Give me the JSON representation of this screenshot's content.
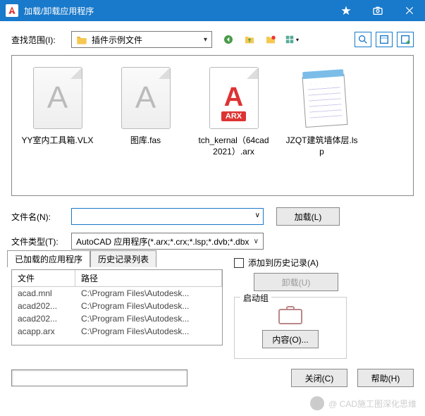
{
  "window": {
    "title": "加载/卸载应用程序"
  },
  "lookIn": {
    "label": "查找范围(I):",
    "value": "插件示例文件"
  },
  "rightTools": [
    "view-tree",
    "view-list",
    "view-add"
  ],
  "files": [
    {
      "name": "YY室内工具箱.VLX",
      "kind": "plain"
    },
    {
      "name": "图库.fas",
      "kind": "plain"
    },
    {
      "name": "tch_kernal（64cad2021）.arx",
      "kind": "arx",
      "badge": "ARX"
    },
    {
      "name": "JZQT建筑墙体层.lsp",
      "kind": "notepad"
    }
  ],
  "fileName": {
    "label": "文件名(N):",
    "value": ""
  },
  "fileType": {
    "label": "文件类型(T):",
    "value": "AutoCAD 应用程序(*.arx;*.crx;*.lsp;*.dvb;*.dbx"
  },
  "buttons": {
    "load": "加载(L)",
    "unload": "卸载(U)",
    "contents": "内容(O)...",
    "close": "关闭(C)",
    "help": "帮助(H)"
  },
  "tabs": {
    "loaded": "已加载的应用程序",
    "history": "历史记录列表"
  },
  "listHeaders": {
    "file": "文件",
    "path": "路径"
  },
  "loadedApps": [
    {
      "file": "acad.mnl",
      "path": "C:\\Program Files\\Autodesk..."
    },
    {
      "file": "acad202...",
      "path": "C:\\Program Files\\Autodesk..."
    },
    {
      "file": "acad202...",
      "path": "C:\\Program Files\\Autodesk..."
    },
    {
      "file": "acapp.arx",
      "path": "C:\\Program Files\\Autodesk..."
    }
  ],
  "addHistory": "添加到历史记录(A)",
  "startup": {
    "legend": "启动组"
  },
  "watermark": "@ CAD施工图深化思维"
}
